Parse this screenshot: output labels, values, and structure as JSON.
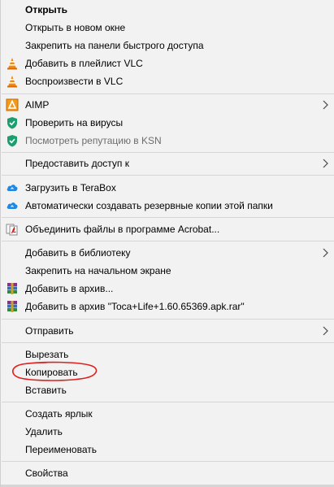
{
  "menu": {
    "items": [
      {
        "label": "Открыть"
      },
      {
        "label": "Открыть в новом окне"
      },
      {
        "label": "Закрепить на панели быстрого доступа"
      },
      {
        "label": "Добавить в плейлист VLC",
        "icon": "vlc-cone-icon"
      },
      {
        "label": "Воспроизвести в VLC",
        "icon": "vlc-cone-icon"
      },
      {
        "label": "AIMP",
        "icon": "aimp-icon"
      },
      {
        "label": "Проверить на вирусы",
        "icon": "kaspersky-shield-icon"
      },
      {
        "label": "Посмотреть репутацию в KSN",
        "icon": "kaspersky-shield-icon"
      },
      {
        "label": "Предоставить доступ к"
      },
      {
        "label": "Загрузить в TeraBox",
        "icon": "terabox-cloud-icon"
      },
      {
        "label": "Автоматически создавать резервные копии этой папки",
        "icon": "terabox-cloud-icon"
      },
      {
        "label": "Объединить файлы в программе Acrobat...",
        "icon": "acrobat-icon"
      },
      {
        "label": "Добавить в библиотеку"
      },
      {
        "label": "Закрепить на начальном экране"
      },
      {
        "label": "Добавить в архив...",
        "icon": "winrar-icon"
      },
      {
        "label": "Добавить в архив \"Toca+Life+1.60.65369.apk.rar\"",
        "icon": "winrar-icon"
      },
      {
        "label": "Отправить"
      },
      {
        "label": "Вырезать"
      },
      {
        "label": "Копировать"
      },
      {
        "label": "Вставить"
      },
      {
        "label": "Создать ярлык"
      },
      {
        "label": "Удалить"
      },
      {
        "label": "Переименовать"
      },
      {
        "label": "Свойства"
      }
    ]
  },
  "colors": {
    "background": "#f2f2f2",
    "separator": "#d6d6d6",
    "disabled_text": "#6d6d6d",
    "highlight_circle": "#e0201e",
    "vlc_orange": "#f08a14",
    "kaspersky_green": "#1d9e6e",
    "terabox_blue": "#1e88e5",
    "aimp_orange": "#f29a1e"
  }
}
